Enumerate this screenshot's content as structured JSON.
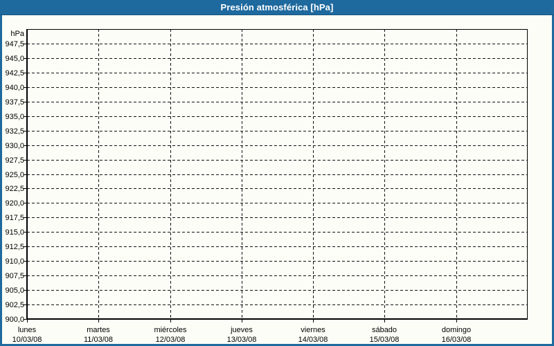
{
  "window": {
    "title_bar_color": "#1e699e",
    "border_color": "#1e699e",
    "background_color": "#fbfdf6"
  },
  "chart_data": {
    "type": "line",
    "title": "Presión atmosférica [hPa]",
    "unit_label": "hPa",
    "grid": "dashed",
    "legend": "none",
    "plot_fill": "#fbfdf6",
    "grid_color": "#111111",
    "axis_color": "#000000",
    "series": [],
    "y_axis": {
      "min": 900,
      "max": 950,
      "step": 2.5,
      "ticks": [
        {
          "value": 947.5,
          "label": "947,5",
          "gridline": true
        },
        {
          "value": 945.0,
          "label": "945,0",
          "gridline": true
        },
        {
          "value": 942.5,
          "label": "942,5",
          "gridline": true
        },
        {
          "value": 940.0,
          "label": "940,0",
          "gridline": true
        },
        {
          "value": 937.5,
          "label": "937,5",
          "gridline": true
        },
        {
          "value": 935.0,
          "label": "935,0",
          "gridline": true
        },
        {
          "value": 932.5,
          "label": "932,5",
          "gridline": true
        },
        {
          "value": 930.0,
          "label": "930,0",
          "gridline": true
        },
        {
          "value": 927.5,
          "label": "927,5",
          "gridline": true
        },
        {
          "value": 925.0,
          "label": "925,0",
          "gridline": true
        },
        {
          "value": 922.5,
          "label": "922,5",
          "gridline": true
        },
        {
          "value": 920.0,
          "label": "920,0",
          "gridline": true
        },
        {
          "value": 917.5,
          "label": "917,5",
          "gridline": true
        },
        {
          "value": 915.0,
          "label": "915,0",
          "gridline": true
        },
        {
          "value": 912.5,
          "label": "912,5",
          "gridline": true
        },
        {
          "value": 910.0,
          "label": "910,0",
          "gridline": true
        },
        {
          "value": 907.5,
          "label": "907,5",
          "gridline": true
        },
        {
          "value": 905.0,
          "label": "905,0",
          "gridline": true
        },
        {
          "value": 902.5,
          "label": "902,5",
          "gridline": true
        },
        {
          "value": 900.0,
          "label": "900,0",
          "gridline": false
        }
      ]
    },
    "x_axis": {
      "categories": [
        {
          "day": "lunes",
          "date": "10/03/08"
        },
        {
          "day": "martes",
          "date": "11/03/08"
        },
        {
          "day": "miércoles",
          "date": "12/03/08"
        },
        {
          "day": "jueves",
          "date": "13/03/08"
        },
        {
          "day": "viernes",
          "date": "14/03/08"
        },
        {
          "day": "sábado",
          "date": "15/03/08"
        },
        {
          "day": "domingo",
          "date": "16/03/08"
        }
      ]
    }
  }
}
